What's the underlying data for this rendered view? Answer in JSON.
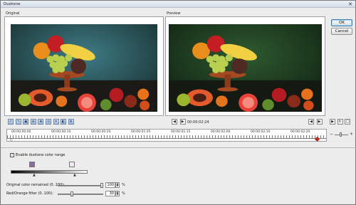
{
  "window": {
    "title": "Duotone",
    "close_glyph": "✕"
  },
  "panels": {
    "original_label": "Original",
    "preview_label": "Preview"
  },
  "buttons": {
    "ok": "OK",
    "cancel": "Cancel"
  },
  "toolbar": {
    "icons": [
      "undo-icon",
      "redo-icon",
      "fit-icon",
      "zoom-icon",
      "pan-icon",
      "reset-icon",
      "crop-icon",
      "compare-icon",
      "settings-icon"
    ]
  },
  "transport": {
    "timecode": "00:00:02:24",
    "prev_frame_glyph": "◀|",
    "prev_glyph": "|◀",
    "next_glyph": "▶|",
    "last_glyph": "|▶",
    "play_glyph": "▶"
  },
  "timeline": {
    "ticks": [
      "00:00:00:00",
      "00:00:00:10",
      "00:00:00:20",
      "00:00:01:05",
      "00:00:01:15",
      "00:00:02:00",
      "00:00:02:10",
      "00:00:02:20"
    ],
    "current_position_fraction": 0.97
  },
  "zoom": {
    "minus": "−",
    "plus": "+"
  },
  "duotone": {
    "enable_label": "Enable duotone color range",
    "enabled": true,
    "color_dark": "#8a6ea0",
    "color_light": "#f2e6f4",
    "gradient_from": "#000000",
    "gradient_to": "#ffffff"
  },
  "sliders": [
    {
      "label": "Original color remained (0..100):",
      "value": "100",
      "unit": "%",
      "fraction": 1.0
    },
    {
      "label": "Red/Orange filter (0..100):",
      "value": "30",
      "unit": "%",
      "fraction": 0.3
    }
  ]
}
